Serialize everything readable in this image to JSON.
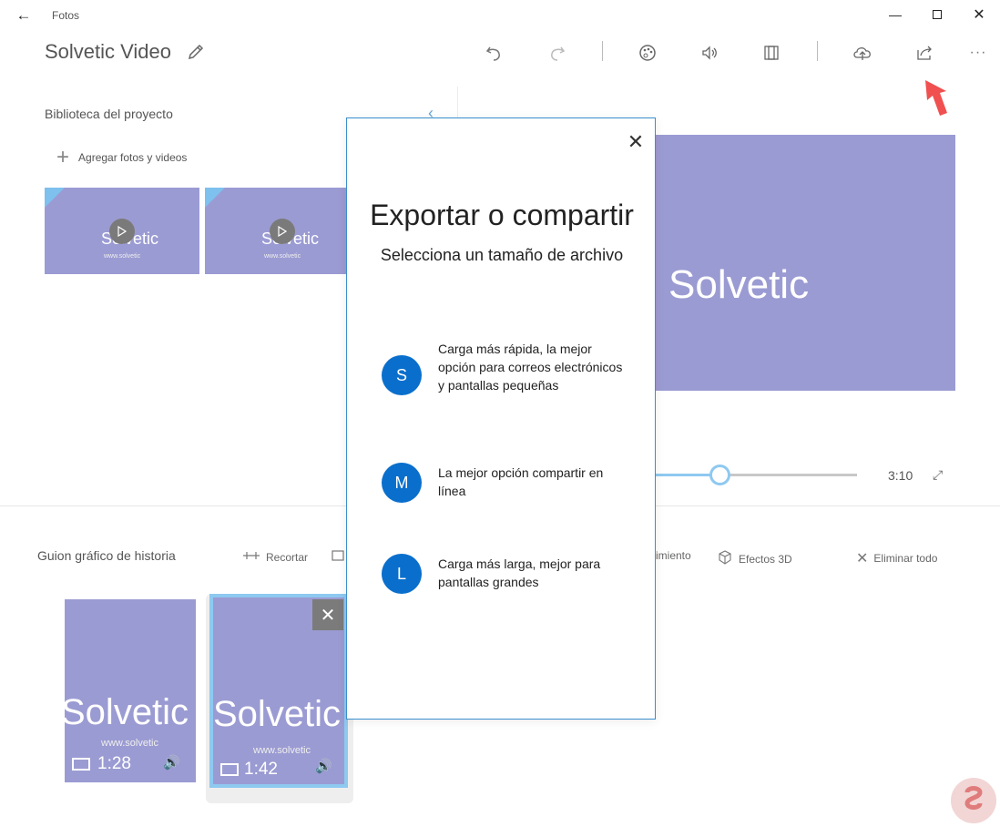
{
  "window": {
    "title": "Fotos"
  },
  "project": {
    "title": "Solvetic Video"
  },
  "library": {
    "title": "Biblioteca del proyecto",
    "add_label": "Agregar fotos y videos",
    "thumbs": [
      {
        "logo": "Solvetic",
        "url": "www.solvetic"
      },
      {
        "logo": "Solvetic",
        "url": "www.solvetic"
      }
    ]
  },
  "preview": {
    "logo": "Solvetic",
    "time": "3:10",
    "progress_fraction": 0.32
  },
  "storyboard": {
    "title": "Guion gráfico de historia",
    "actions": {
      "trim": "Recortar",
      "motion": "imiento",
      "effects3d": "Efectos 3D",
      "remove_all": "Eliminar todo"
    },
    "cards": [
      {
        "logo": "Solvetic",
        "url": "www.solvetic",
        "duration": "1:28"
      },
      {
        "logo": "Solvetic",
        "url": "www.solvetic",
        "duration": "1:42"
      }
    ]
  },
  "dialog": {
    "title": "Exportar o compartir",
    "subtitle": "Selecciona un tamaño de archivo",
    "options": [
      {
        "letter": "S",
        "text": "Carga más rápida, la mejor opción para correos electrónicos y pantallas pequeñas"
      },
      {
        "letter": "M",
        "text": "La mejor opción compartir en línea"
      },
      {
        "letter": "L",
        "text": "Carga más larga, mejor para pantallas grandes"
      }
    ]
  },
  "colors": {
    "accent": "#0a6fcc",
    "thumb_bg": "#9b9bd3",
    "slider": "#8ec9f0",
    "arrow": "#f0504f"
  },
  "icons": [
    "back-arrow-icon",
    "minimize-icon",
    "maximize-icon",
    "close-icon",
    "pencil-icon",
    "undo-icon",
    "redo-icon",
    "palette-icon",
    "volume-icon",
    "aspect-ratio-icon",
    "cloud-upload-icon",
    "share-icon",
    "more-icon",
    "collapse-chevron-icon",
    "expand-icon",
    "trim-icon",
    "3d-effects-icon",
    "film-icon"
  ]
}
